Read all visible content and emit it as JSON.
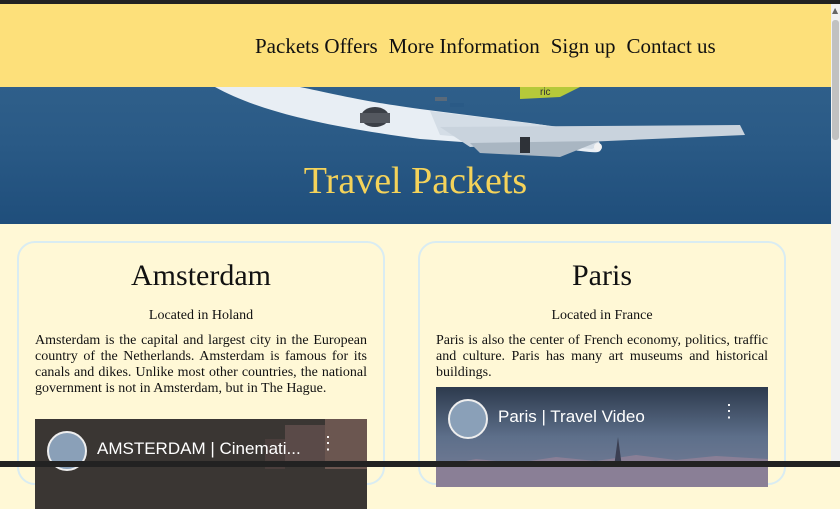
{
  "nav": {
    "items": [
      "Packets Offers",
      "More Information",
      "Sign up",
      "Contact us"
    ]
  },
  "hero": {
    "title": "Travel Packets"
  },
  "cards": [
    {
      "city": "Amsterdam",
      "location": "Located in Holand",
      "description": "Amsterdam is the capital and largest city in the European country of the Netherlands. Amsterdam is famous for its canals and dikes. Unlike most other countries, the national government is not in Amsterdam, but in The Hague.",
      "video_title": "AMSTERDAM | Cinemati..."
    },
    {
      "city": "Paris",
      "location": "Located in France",
      "description": "Paris is also the center of French economy, politics, traffic and culture. Paris has many art museums and historical buildings.",
      "video_title": "Paris | Travel Video"
    }
  ],
  "colors": {
    "navbar": "#fde07a",
    "hero_bg": "#2a5a86",
    "hero_title": "#f5d35a",
    "page_bg": "#fff8d6",
    "card_border": "#d9ecf2"
  }
}
